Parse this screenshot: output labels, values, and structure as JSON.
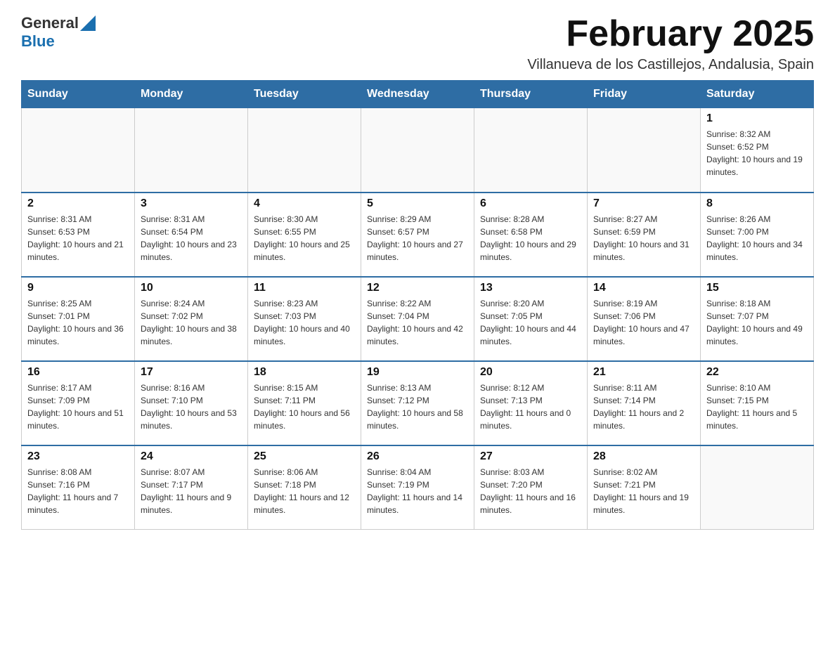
{
  "logo": {
    "general": "General",
    "blue": "Blue"
  },
  "title": "February 2025",
  "location": "Villanueva de los Castillejos, Andalusia, Spain",
  "days_of_week": [
    "Sunday",
    "Monday",
    "Tuesday",
    "Wednesday",
    "Thursday",
    "Friday",
    "Saturday"
  ],
  "weeks": [
    [
      {
        "day": "",
        "info": ""
      },
      {
        "day": "",
        "info": ""
      },
      {
        "day": "",
        "info": ""
      },
      {
        "day": "",
        "info": ""
      },
      {
        "day": "",
        "info": ""
      },
      {
        "day": "",
        "info": ""
      },
      {
        "day": "1",
        "info": "Sunrise: 8:32 AM\nSunset: 6:52 PM\nDaylight: 10 hours and 19 minutes."
      }
    ],
    [
      {
        "day": "2",
        "info": "Sunrise: 8:31 AM\nSunset: 6:53 PM\nDaylight: 10 hours and 21 minutes."
      },
      {
        "day": "3",
        "info": "Sunrise: 8:31 AM\nSunset: 6:54 PM\nDaylight: 10 hours and 23 minutes."
      },
      {
        "day": "4",
        "info": "Sunrise: 8:30 AM\nSunset: 6:55 PM\nDaylight: 10 hours and 25 minutes."
      },
      {
        "day": "5",
        "info": "Sunrise: 8:29 AM\nSunset: 6:57 PM\nDaylight: 10 hours and 27 minutes."
      },
      {
        "day": "6",
        "info": "Sunrise: 8:28 AM\nSunset: 6:58 PM\nDaylight: 10 hours and 29 minutes."
      },
      {
        "day": "7",
        "info": "Sunrise: 8:27 AM\nSunset: 6:59 PM\nDaylight: 10 hours and 31 minutes."
      },
      {
        "day": "8",
        "info": "Sunrise: 8:26 AM\nSunset: 7:00 PM\nDaylight: 10 hours and 34 minutes."
      }
    ],
    [
      {
        "day": "9",
        "info": "Sunrise: 8:25 AM\nSunset: 7:01 PM\nDaylight: 10 hours and 36 minutes."
      },
      {
        "day": "10",
        "info": "Sunrise: 8:24 AM\nSunset: 7:02 PM\nDaylight: 10 hours and 38 minutes."
      },
      {
        "day": "11",
        "info": "Sunrise: 8:23 AM\nSunset: 7:03 PM\nDaylight: 10 hours and 40 minutes."
      },
      {
        "day": "12",
        "info": "Sunrise: 8:22 AM\nSunset: 7:04 PM\nDaylight: 10 hours and 42 minutes."
      },
      {
        "day": "13",
        "info": "Sunrise: 8:20 AM\nSunset: 7:05 PM\nDaylight: 10 hours and 44 minutes."
      },
      {
        "day": "14",
        "info": "Sunrise: 8:19 AM\nSunset: 7:06 PM\nDaylight: 10 hours and 47 minutes."
      },
      {
        "day": "15",
        "info": "Sunrise: 8:18 AM\nSunset: 7:07 PM\nDaylight: 10 hours and 49 minutes."
      }
    ],
    [
      {
        "day": "16",
        "info": "Sunrise: 8:17 AM\nSunset: 7:09 PM\nDaylight: 10 hours and 51 minutes."
      },
      {
        "day": "17",
        "info": "Sunrise: 8:16 AM\nSunset: 7:10 PM\nDaylight: 10 hours and 53 minutes."
      },
      {
        "day": "18",
        "info": "Sunrise: 8:15 AM\nSunset: 7:11 PM\nDaylight: 10 hours and 56 minutes."
      },
      {
        "day": "19",
        "info": "Sunrise: 8:13 AM\nSunset: 7:12 PM\nDaylight: 10 hours and 58 minutes."
      },
      {
        "day": "20",
        "info": "Sunrise: 8:12 AM\nSunset: 7:13 PM\nDaylight: 11 hours and 0 minutes."
      },
      {
        "day": "21",
        "info": "Sunrise: 8:11 AM\nSunset: 7:14 PM\nDaylight: 11 hours and 2 minutes."
      },
      {
        "day": "22",
        "info": "Sunrise: 8:10 AM\nSunset: 7:15 PM\nDaylight: 11 hours and 5 minutes."
      }
    ],
    [
      {
        "day": "23",
        "info": "Sunrise: 8:08 AM\nSunset: 7:16 PM\nDaylight: 11 hours and 7 minutes."
      },
      {
        "day": "24",
        "info": "Sunrise: 8:07 AM\nSunset: 7:17 PM\nDaylight: 11 hours and 9 minutes."
      },
      {
        "day": "25",
        "info": "Sunrise: 8:06 AM\nSunset: 7:18 PM\nDaylight: 11 hours and 12 minutes."
      },
      {
        "day": "26",
        "info": "Sunrise: 8:04 AM\nSunset: 7:19 PM\nDaylight: 11 hours and 14 minutes."
      },
      {
        "day": "27",
        "info": "Sunrise: 8:03 AM\nSunset: 7:20 PM\nDaylight: 11 hours and 16 minutes."
      },
      {
        "day": "28",
        "info": "Sunrise: 8:02 AM\nSunset: 7:21 PM\nDaylight: 11 hours and 19 minutes."
      },
      {
        "day": "",
        "info": ""
      }
    ]
  ]
}
